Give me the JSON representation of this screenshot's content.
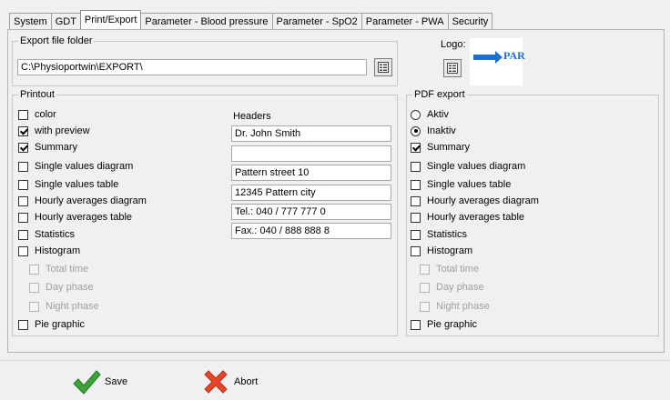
{
  "tabs": [
    {
      "label": "System"
    },
    {
      "label": "GDT"
    },
    {
      "label": "Print/Export"
    },
    {
      "label": "Parameter - Blood pressure"
    },
    {
      "label": "Parameter - SpO2"
    },
    {
      "label": "Parameter - PWA"
    },
    {
      "label": "Security"
    }
  ],
  "export": {
    "title": "Export file folder",
    "path": "C:\\Physioportwin\\EXPORT\\"
  },
  "logo": {
    "label": "Logo:",
    "brand_text": "PAR",
    "brand_color": "#1f6fd0"
  },
  "printout": {
    "title": "Printout",
    "items": [
      {
        "label": "color",
        "checked": false
      },
      {
        "label": "with preview",
        "checked": true
      },
      {
        "label": "Summary",
        "checked": true
      },
      {
        "label": "Single values diagram",
        "checked": false
      },
      {
        "label": "Single values table",
        "checked": false
      },
      {
        "label": "Hourly averages diagram",
        "checked": false
      },
      {
        "label": "Hourly averages table",
        "checked": false
      },
      {
        "label": "Statistics",
        "checked": false
      },
      {
        "label": "Histogram",
        "checked": false
      },
      {
        "label": "Total time",
        "checked": false,
        "disabled": true
      },
      {
        "label": "Day phase",
        "checked": false,
        "disabled": true
      },
      {
        "label": "Night phase",
        "checked": false,
        "disabled": true
      },
      {
        "label": "Pie graphic",
        "checked": false
      }
    ],
    "headers_label": "Headers",
    "headers": [
      "Dr. John Smith",
      "",
      "Pattern street 10",
      "12345 Pattern city",
      "Tel.: 040 / 777 777 0",
      "Fax.: 040 / 888 888 8"
    ]
  },
  "pdf": {
    "title": "PDF export",
    "radios": [
      {
        "label": "Aktiv",
        "checked": false
      },
      {
        "label": "Inaktiv",
        "checked": true
      }
    ],
    "items": [
      {
        "label": "Summary",
        "checked": true
      },
      {
        "label": "Single values diagram",
        "checked": false
      },
      {
        "label": "Single values table",
        "checked": false
      },
      {
        "label": "Hourly averages diagram",
        "checked": false
      },
      {
        "label": "Hourly averages table",
        "checked": false
      },
      {
        "label": "Statistics",
        "checked": false
      },
      {
        "label": "Histogram",
        "checked": false
      },
      {
        "label": "Total time",
        "checked": false,
        "disabled": true
      },
      {
        "label": "Day phase",
        "checked": false,
        "disabled": true
      },
      {
        "label": "Night phase",
        "checked": false,
        "disabled": true
      },
      {
        "label": "Pie graphic",
        "checked": false
      }
    ]
  },
  "footer": {
    "save_label": "Save",
    "abort_label": "Abort"
  },
  "colors": {
    "save_icon": "#3aa33a",
    "abort_icon": "#e8462a"
  }
}
